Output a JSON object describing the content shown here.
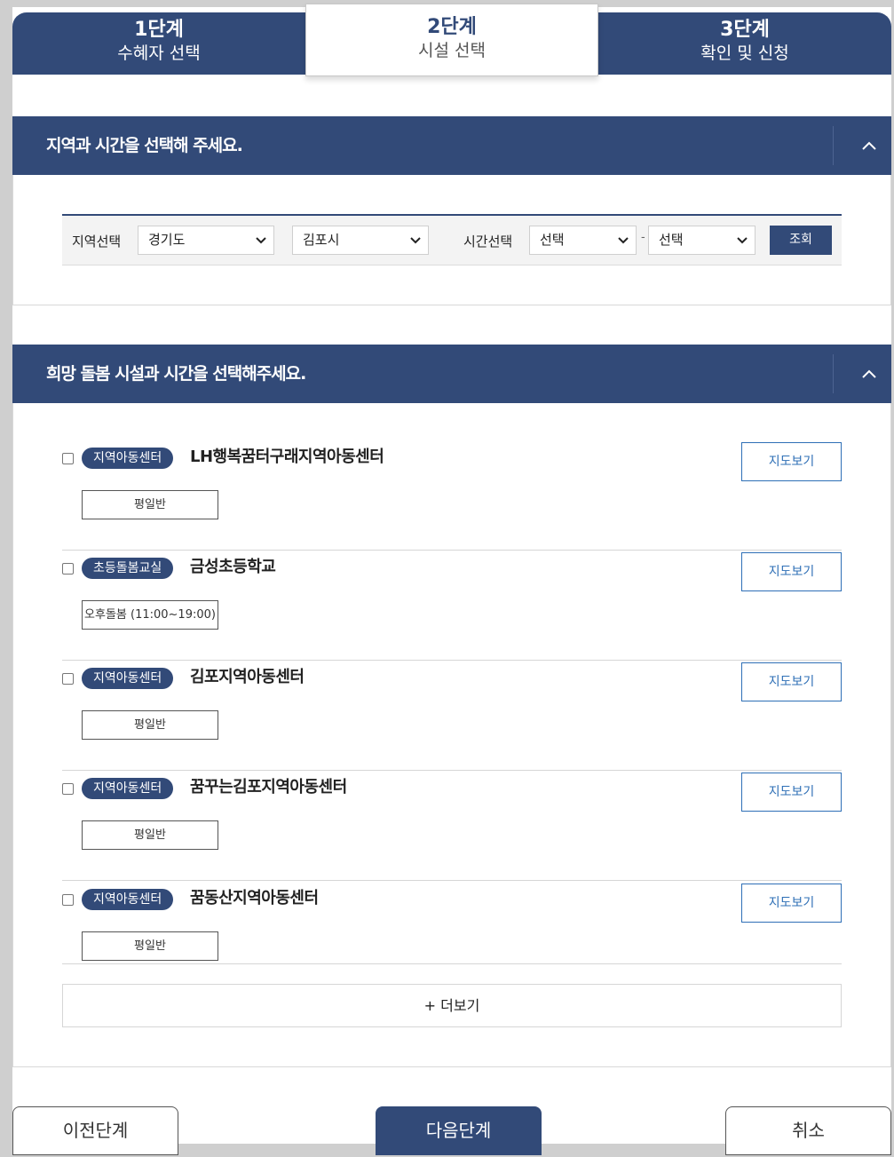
{
  "steps": [
    {
      "num": "1단계",
      "label": "수혜자 선택"
    },
    {
      "num": "2단계",
      "label": "시설 선택"
    },
    {
      "num": "3단계",
      "label": "확인 및 신청"
    }
  ],
  "section1": {
    "title": "지역과 시간을 선택해 주세요.",
    "filter": {
      "region_label": "지역선택",
      "province": "경기도",
      "city": "김포시",
      "time_label": "시간선택",
      "time_from": "선택",
      "separator": "-",
      "time_to": "선택",
      "query_button": "조회"
    }
  },
  "section2": {
    "title": "희망 돌봄 시설과 시간을 선택해주세요.",
    "facilities": [
      {
        "type": "지역아동센터",
        "name": "LH행복꿈터구래지역아동센터",
        "tag": "평일반",
        "map_button": "지도보기"
      },
      {
        "type": "초등돌봄교실",
        "name": "금성초등학교",
        "tag": "오후돌봄 (11:00~19:00)",
        "map_button": "지도보기"
      },
      {
        "type": "지역아동센터",
        "name": "김포지역아동센터",
        "tag": "평일반",
        "map_button": "지도보기"
      },
      {
        "type": "지역아동센터",
        "name": "꿈꾸는김포지역아동센터",
        "tag": "평일반",
        "map_button": "지도보기"
      },
      {
        "type": "지역아동센터",
        "name": "꿈동산지역아동센터",
        "tag": "평일반",
        "map_button": "지도보기"
      }
    ],
    "more_button": "+ 더보기"
  },
  "footer": {
    "prev_button": "이전단계",
    "next_button": "다음단계",
    "cancel_button": "취소"
  },
  "colors": {
    "primary": "#324a78",
    "link_blue": "#2e6fb6",
    "background_gray": "#cfcfcf"
  }
}
